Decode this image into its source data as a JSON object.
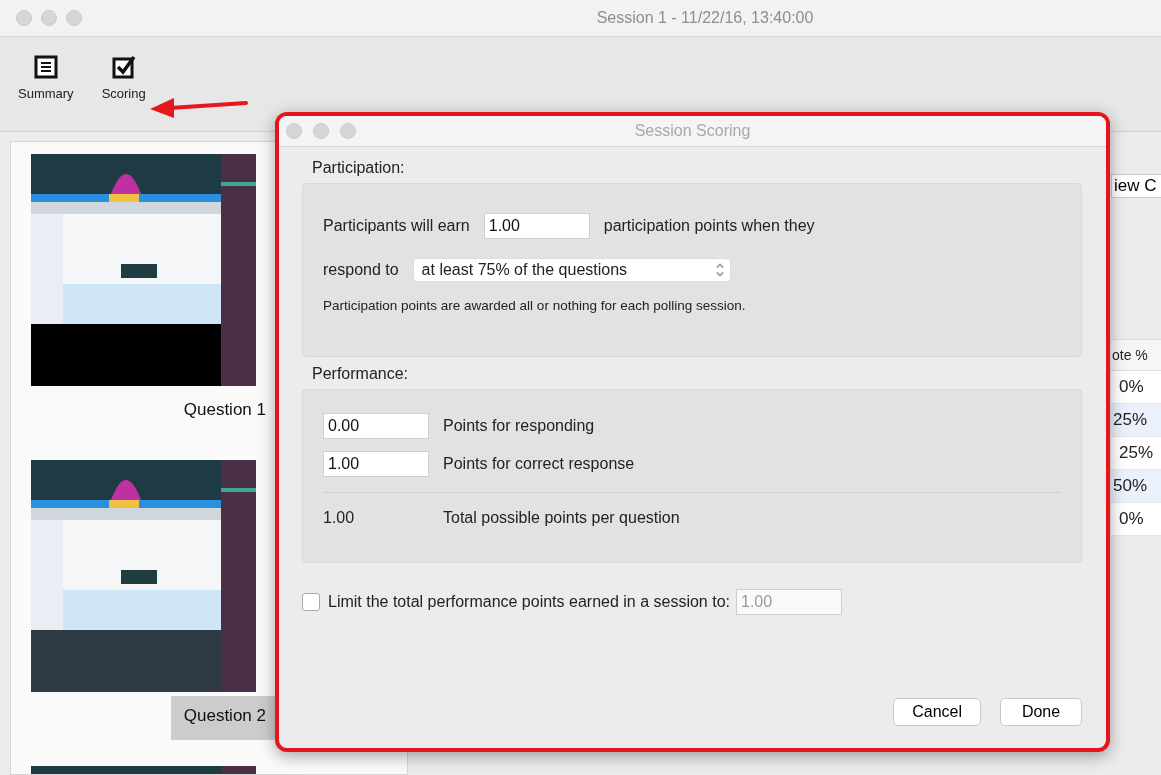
{
  "window": {
    "title": "Session 1 - 11/22/16, 13:40:00"
  },
  "toolbar": [
    {
      "label": "Summary",
      "kind": "summary"
    },
    {
      "label": "Scoring",
      "kind": "scoring"
    }
  ],
  "slides": [
    {
      "label": "Question 1",
      "selected": false,
      "kind": "picture"
    },
    {
      "label": "Question 2",
      "selected": true,
      "kind": "picture"
    },
    {
      "kind": "picture"
    }
  ],
  "results": {
    "button": "iew C",
    "column": "ote %",
    "rows": [
      "0%",
      "25%",
      "25%",
      "50%",
      "0%"
    ]
  },
  "dialog": {
    "title": "Session Scoring",
    "participation": {
      "heading": "Participation:",
      "earn_label": "Participants will earn",
      "points_value": "1.00",
      "points_suffix": "participation points when they",
      "respond_label": "respond to",
      "respond_choice": "at least 75% of the questions",
      "note": "Participation points are awarded all or nothing for each polling session."
    },
    "performance": {
      "heading": "Performance:",
      "rows": [
        {
          "value": "0.00",
          "label": "Points for responding"
        },
        {
          "value": "1.00",
          "label": "Points for correct response"
        }
      ],
      "total_value": "1.00",
      "total_label": "Total possible points per question"
    },
    "limit": {
      "checked": false,
      "label": "Limit the total performance points earned in a session to:",
      "value": "1.00",
      "disabled": true
    },
    "buttons": [
      "Cancel",
      "Done"
    ]
  }
}
